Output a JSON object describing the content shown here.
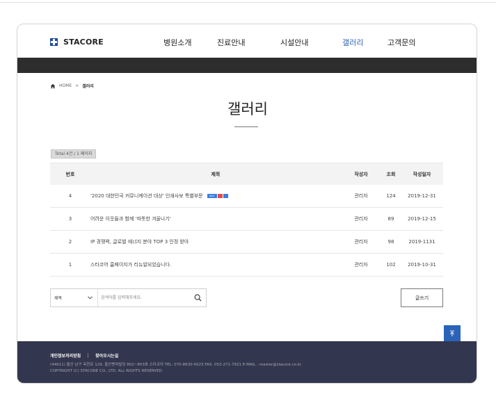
{
  "header": {
    "logo_text": "STACORE",
    "nav": [
      "병원소개",
      "진료안내",
      "시설안내",
      "갤러리",
      "고객문의"
    ],
    "active_nav": "갤러리"
  },
  "breadcrumb": {
    "home": "HOME",
    "separator": ">",
    "current": "갤러리"
  },
  "page_title": "갤러리",
  "total_text": "Total 4건 / 1 페이지",
  "table": {
    "headers": {
      "num": "번호",
      "title": "제목",
      "author": "작성자",
      "views": "조회",
      "date": "작성일자"
    },
    "rows": [
      {
        "num": "4",
        "title": "'2020 대한민국 커뮤니케이션 대상' 인쇄사보 특별부문",
        "author": "관리자",
        "views": "124",
        "date": "2019-12-31",
        "badges": [
          "new-icon",
          "image-icon",
          "file-icon"
        ]
      },
      {
        "num": "3",
        "title": "어려운 이웃들과 함께 '따뜻한 겨울나기'",
        "author": "관리자",
        "views": "89",
        "date": "2019-12-15",
        "badges": []
      },
      {
        "num": "2",
        "title": "IP 경쟁력, 글로벌 에너지 분야 TOP 3 인정 받아",
        "author": "관리자",
        "views": "98",
        "date": "2019-1131",
        "badges": []
      },
      {
        "num": "1",
        "title": "스타코어 홈페이지가 리뉴얼되었습니다.",
        "author": "관리자",
        "views": "102",
        "date": "2019-10-31",
        "badges": []
      }
    ],
    "new_badge_label": "NEW"
  },
  "search": {
    "select_value": "제목",
    "placeholder": "검색어를 입력해주세요."
  },
  "write_button": "글쓰기",
  "footer": {
    "links": [
      "개인정보처리방침",
      "찾아오시는길"
    ],
    "address": "(44611) 울산 남구 옥현로 129, 울산벤처빌딩 802~803호  스타코어  TEL. 070-8630-0023   FAX. 052-271-7921  E-MAIL : master@stacore.co.kr",
    "copyright": "COPYRIGHT (C) STACORE CO., LTD. ALL RIGHTS RESERVED."
  },
  "colors": {
    "accent": "#2d63b5",
    "dark_bar": "#2d2d2d",
    "footer_bg": "#32364e",
    "top_button": "#2a63b8"
  }
}
